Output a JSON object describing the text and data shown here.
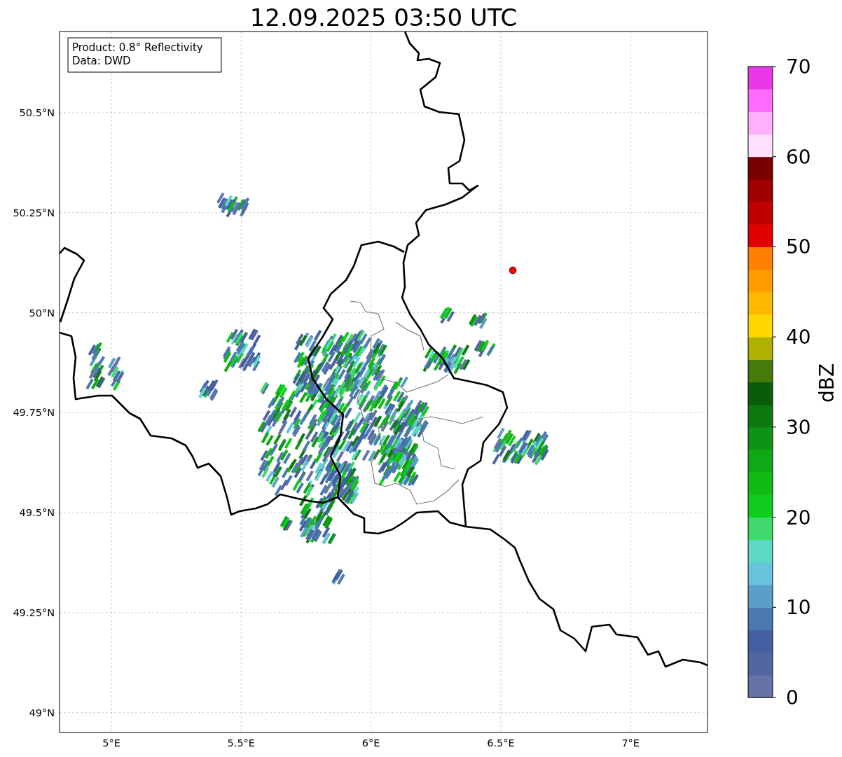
{
  "title": "12.09.2025 03:50 UTC",
  "info_box": {
    "lines": [
      "Product: 0.8° Reflectivity",
      "Data: DWD"
    ]
  },
  "map": {
    "y_ticks": [
      "50.5°N",
      "50.25°N",
      "50°N",
      "49.75°N",
      "49.5°N",
      "49.25°N",
      "49°N"
    ],
    "x_ticks": [
      "5°E",
      "5.5°E",
      "6°E",
      "6.5°E",
      "7°E"
    ]
  },
  "colorbar": {
    "label": "dBZ",
    "ticks": [
      "70",
      "60",
      "50",
      "40",
      "30",
      "20",
      "10",
      "0"
    ],
    "bins": [
      {
        "color": "#6673a6"
      },
      {
        "color": "#5366a0"
      },
      {
        "color": "#4560a2"
      },
      {
        "color": "#4a7ab0"
      },
      {
        "color": "#5a9fc8"
      },
      {
        "color": "#68c3dc"
      },
      {
        "color": "#5ed8c4"
      },
      {
        "color": "#3ed86c"
      },
      {
        "color": "#10cc1c"
      },
      {
        "color": "#10bc14"
      },
      {
        "color": "#10a814"
      },
      {
        "color": "#0e9414"
      },
      {
        "color": "#0c7a10"
      },
      {
        "color": "#0a5c0a"
      },
      {
        "color": "#467a0a"
      },
      {
        "color": "#b0b000"
      },
      {
        "color": "#ffd700"
      },
      {
        "color": "#ffb800"
      },
      {
        "color": "#ff9c00"
      },
      {
        "color": "#ff7f00"
      },
      {
        "color": "#e00000"
      },
      {
        "color": "#c00000"
      },
      {
        "color": "#a00000"
      },
      {
        "color": "#7a0000"
      },
      {
        "color": "#ffe0ff"
      },
      {
        "color": "#ffb0ff"
      },
      {
        "color": "#ff6cff"
      },
      {
        "color": "#e838e8"
      }
    ]
  }
}
